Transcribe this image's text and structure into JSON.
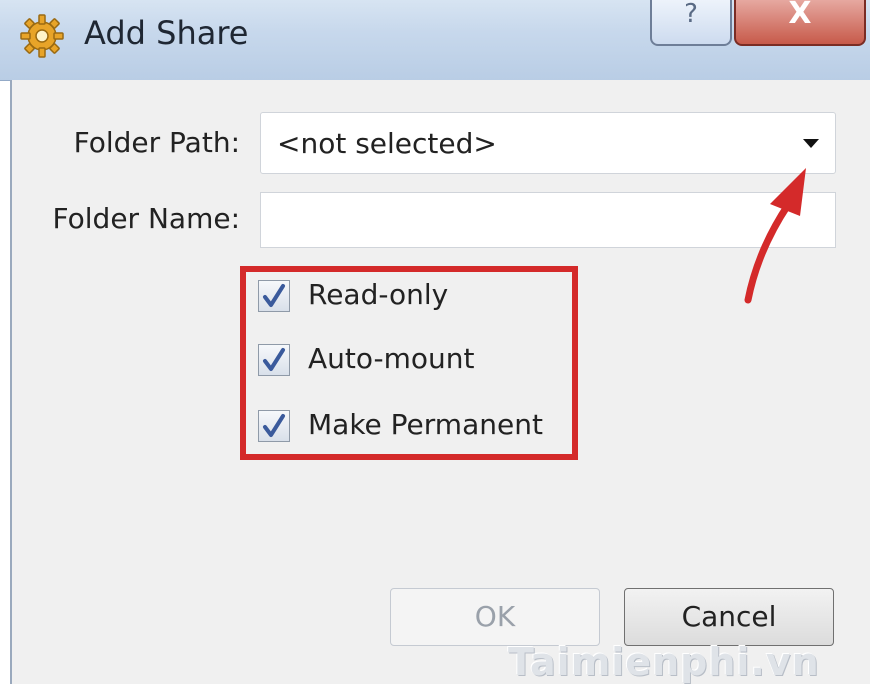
{
  "window": {
    "title": "Add Share",
    "help_glyph": "?",
    "close_glyph": "X"
  },
  "form": {
    "folder_path_label": "Folder Path:",
    "folder_path_value": "<not selected>",
    "folder_name_label": "Folder Name:",
    "folder_name_value": ""
  },
  "options": [
    {
      "label": "Read-only",
      "checked": true
    },
    {
      "label": "Auto-mount",
      "checked": true
    },
    {
      "label": "Make Permanent",
      "checked": true
    }
  ],
  "buttons": {
    "ok_label": "OK",
    "cancel_label": "Cancel"
  },
  "watermark": "Taimienphi.vn",
  "colors": {
    "highlight": "#d42a2a",
    "arrow": "#d42a2a",
    "check": "#3a5a9c"
  },
  "icons": [
    "gear-app-icon",
    "help-icon",
    "close-icon",
    "dropdown-arrow-icon",
    "check-icon",
    "annotation-arrow-icon"
  ]
}
